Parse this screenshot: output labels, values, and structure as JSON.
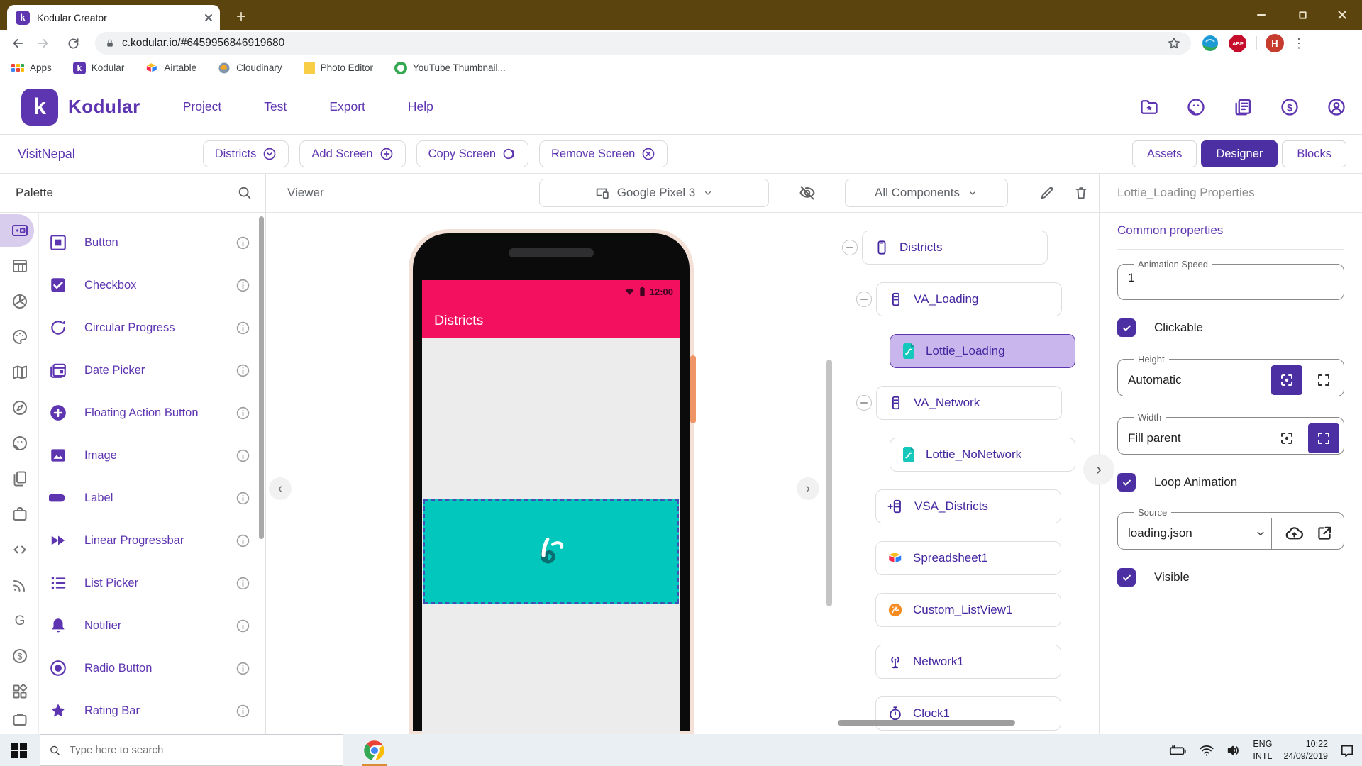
{
  "browser": {
    "tab_title": "Kodular Creator",
    "url": "c.kodular.io/#6459956846919680",
    "bookmarks": [
      "Apps",
      "Kodular",
      "Airtable",
      "Cloudinary",
      "Photo Editor",
      "YouTube Thumbnail..."
    ],
    "extensions": {
      "adblock_label": "ABP",
      "profile_initial": "H"
    }
  },
  "header": {
    "brand": "Kodular",
    "menus": [
      {
        "label": "Project"
      },
      {
        "label": "Test"
      },
      {
        "label": "Export"
      },
      {
        "label": "Help"
      }
    ],
    "icons": [
      "folder-star-icon",
      "community-icon",
      "news-icon",
      "earn-icon",
      "account-icon"
    ]
  },
  "screenbar": {
    "project_name": "VisitNepal",
    "screen_selector": "Districts",
    "add_screen": "Add Screen",
    "copy_screen": "Copy Screen",
    "remove_screen": "Remove Screen",
    "assets": "Assets",
    "designer": "Designer",
    "blocks": "Blocks"
  },
  "palette": {
    "title": "Palette",
    "categories": [
      "user-interface",
      "layout",
      "media",
      "drawing-animation",
      "maps",
      "sensors",
      "social",
      "storage",
      "utilities",
      "experimental",
      "connectivity",
      "google",
      "monetization",
      "extension"
    ],
    "items": [
      {
        "label": "Button",
        "icon": "button-icon"
      },
      {
        "label": "Checkbox",
        "icon": "checkbox-icon"
      },
      {
        "label": "Circular Progress",
        "icon": "circular-progress-icon"
      },
      {
        "label": "Date Picker",
        "icon": "date-picker-icon"
      },
      {
        "label": "Floating Action Button",
        "icon": "fab-icon"
      },
      {
        "label": "Image",
        "icon": "image-icon"
      },
      {
        "label": "Label",
        "icon": "label-icon"
      },
      {
        "label": "Linear Progressbar",
        "icon": "linear-progressbar-icon"
      },
      {
        "label": "List Picker",
        "icon": "list-picker-icon"
      },
      {
        "label": "Notifier",
        "icon": "notifier-icon"
      },
      {
        "label": "Radio Button",
        "icon": "radio-button-icon"
      },
      {
        "label": "Rating Bar",
        "icon": "rating-bar-icon"
      }
    ]
  },
  "viewer": {
    "title": "Viewer",
    "device": "Google Pixel 3",
    "phone": {
      "status_time": "12:00",
      "app_bar_title": "Districts"
    }
  },
  "components_panel": {
    "filter": "All Components",
    "tree": [
      {
        "label": "Districts",
        "icon": "screen-icon",
        "level": 0,
        "collapsible": true
      },
      {
        "label": "VA_Loading",
        "icon": "arrangement-icon",
        "level": 1,
        "collapsible": true
      },
      {
        "label": "Lottie_Loading",
        "icon": "lottie-icon",
        "level": 2,
        "selected": true
      },
      {
        "label": "VA_Network",
        "icon": "arrangement-icon",
        "level": 1,
        "collapsible": true
      },
      {
        "label": "Lottie_NoNetwork",
        "icon": "lottie-icon",
        "level": 2
      },
      {
        "label": "VSA_Districts",
        "icon": "scroll-arrangement-icon",
        "level": 1
      },
      {
        "label": "Spreadsheet1",
        "icon": "airtable-icon",
        "level": 1
      },
      {
        "label": "Custom_ListView1",
        "icon": "custom-listview-icon",
        "level": 1
      },
      {
        "label": "Network1",
        "icon": "network-icon",
        "level": 1
      },
      {
        "label": "Clock1",
        "icon": "clock-icon",
        "level": 1
      }
    ]
  },
  "properties": {
    "title": "Lottie_Loading Properties",
    "section": "Common properties",
    "animation_speed": {
      "label": "Animation Speed",
      "value": "1"
    },
    "clickable": "Clickable",
    "height": {
      "label": "Height",
      "value": "Automatic"
    },
    "width": {
      "label": "Width",
      "value": "Fill parent"
    },
    "loop_animation": "Loop Animation",
    "source": {
      "label": "Source",
      "value": "loading.json"
    },
    "visible": "Visible"
  },
  "taskbar": {
    "search_placeholder": "Type here to search",
    "language": {
      "line1": "ENG",
      "line2": "INTL"
    },
    "clock": {
      "time": "10:22",
      "date": "24/09/2019"
    }
  },
  "colors": {
    "kodular_purple": "#5E35B1",
    "designer_active": "#4B2FA3",
    "appbar_pink": "#F2105F",
    "lottie_teal": "#02C7BD",
    "selection_lavender": "#C8B6EC",
    "titlebar_brown": "#5B440D"
  }
}
